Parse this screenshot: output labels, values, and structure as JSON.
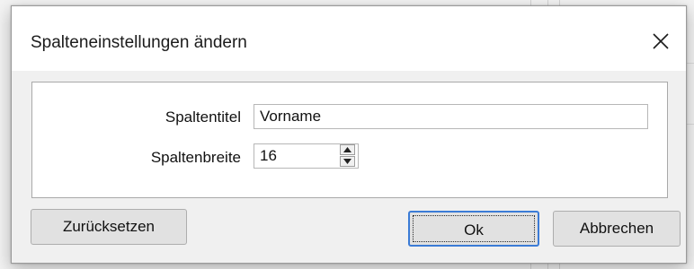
{
  "dialog": {
    "title": "Spalteneinstellungen ändern",
    "close_icon": "close-icon"
  },
  "form": {
    "column_title": {
      "label": "Spaltentitel",
      "value": "Vorname"
    },
    "column_width": {
      "label": "Spaltenbreite",
      "value": "16",
      "up_icon": "arrow-up-icon",
      "down_icon": "arrow-down-icon"
    }
  },
  "buttons": {
    "reset": "Zurücksetzen",
    "ok": "Ok",
    "cancel": "Abbrechen"
  },
  "colors": {
    "focus_border": "#3b7bd6",
    "button_face": "#e1e1e1"
  }
}
